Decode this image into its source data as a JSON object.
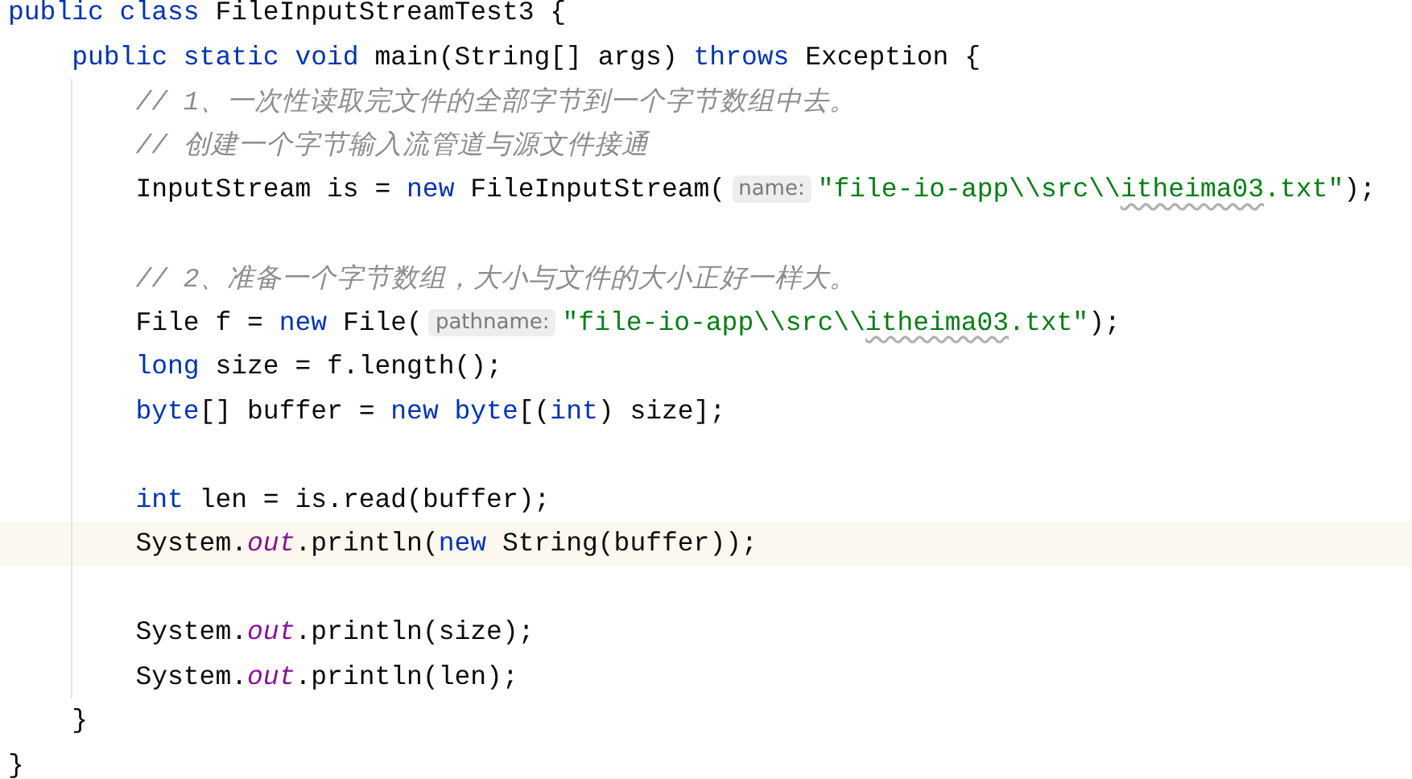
{
  "editor": {
    "lines": [
      {
        "current": false,
        "tokens": [
          {
            "kind": "keyword",
            "text": "public class"
          },
          {
            "kind": "plain",
            "text": " FileInputStreamTest3 {"
          }
        ],
        "children": [
          {
            "current": false,
            "tokens": [
              {
                "kind": "keyword",
                "text": "public static void"
              },
              {
                "kind": "plain",
                "text": " main(String[] args) "
              },
              {
                "kind": "keyword",
                "text": "throws"
              },
              {
                "kind": "plain",
                "text": " Exception {"
              }
            ],
            "children": [
              {
                "current": false,
                "tokens": [
                  {
                    "kind": "comment",
                    "text": "// 1、一次性读取完文件的全部字节到一个字节数组中去。"
                  }
                ]
              },
              {
                "current": false,
                "tokens": [
                  {
                    "kind": "comment",
                    "text": "// 创建一个字节输入流管道与源文件接通"
                  }
                ]
              },
              {
                "current": false,
                "tokens": [
                  {
                    "kind": "plain",
                    "text": "InputStream is = "
                  },
                  {
                    "kind": "keyword",
                    "text": "new"
                  },
                  {
                    "kind": "plain",
                    "text": " FileInputStream("
                  },
                  {
                    "kind": "hint",
                    "text": "name:"
                  },
                  {
                    "kind": "string",
                    "text": "\"file-io-app\\\\src\\\\"
                  },
                  {
                    "kind": "string",
                    "text": "itheima03",
                    "typo": true
                  },
                  {
                    "kind": "string",
                    "text": ".txt\""
                  },
                  {
                    "kind": "plain",
                    "text": ");"
                  }
                ]
              },
              {
                "current": false
              },
              {
                "current": false,
                "tokens": [
                  {
                    "kind": "comment",
                    "text": "// 2、准备一个字节数组，大小与文件的大小正好一样大。"
                  }
                ]
              },
              {
                "current": false,
                "tokens": [
                  {
                    "kind": "plain",
                    "text": "File f = "
                  },
                  {
                    "kind": "keyword",
                    "text": "new"
                  },
                  {
                    "kind": "plain",
                    "text": " File("
                  },
                  {
                    "kind": "hint",
                    "text": "pathname:"
                  },
                  {
                    "kind": "string",
                    "text": "\"file-io-app\\\\src\\\\"
                  },
                  {
                    "kind": "string",
                    "text": "itheima03",
                    "typo": true
                  },
                  {
                    "kind": "string",
                    "text": ".txt\""
                  },
                  {
                    "kind": "plain",
                    "text": ");"
                  }
                ]
              },
              {
                "current": false,
                "tokens": [
                  {
                    "kind": "keyword",
                    "text": "long"
                  },
                  {
                    "kind": "plain",
                    "text": " size = f.length();"
                  }
                ]
              },
              {
                "current": false,
                "tokens": [
                  {
                    "kind": "keyword",
                    "text": "byte"
                  },
                  {
                    "kind": "plain",
                    "text": "[] buffer = "
                  },
                  {
                    "kind": "keyword",
                    "text": "new byte"
                  },
                  {
                    "kind": "plain",
                    "text": "[("
                  },
                  {
                    "kind": "keyword",
                    "text": "int"
                  },
                  {
                    "kind": "plain",
                    "text": ") size];"
                  }
                ]
              },
              {
                "current": false
              },
              {
                "current": false,
                "tokens": [
                  {
                    "kind": "keyword",
                    "text": "int"
                  },
                  {
                    "kind": "plain",
                    "text": " len = is.read(buffer);"
                  }
                ]
              },
              {
                "current": true,
                "tokens": [
                  {
                    "kind": "plain",
                    "text": "System."
                  },
                  {
                    "kind": "static",
                    "text": "out"
                  },
                  {
                    "kind": "plain",
                    "text": ".println("
                  },
                  {
                    "kind": "keyword",
                    "text": "new"
                  },
                  {
                    "kind": "plain",
                    "text": " String(buffer));"
                  }
                ]
              },
              {
                "current": false
              },
              {
                "current": false,
                "tokens": [
                  {
                    "kind": "plain",
                    "text": "System."
                  },
                  {
                    "kind": "static",
                    "text": "out"
                  },
                  {
                    "kind": "plain",
                    "text": ".println(size);"
                  }
                ]
              },
              {
                "current": false,
                "tokens": [
                  {
                    "kind": "plain",
                    "text": "System."
                  },
                  {
                    "kind": "static",
                    "text": "out"
                  },
                  {
                    "kind": "plain",
                    "text": ".println(len);"
                  }
                ]
              }
            ]
          },
          {
            "current": false,
            "tokens": [
              {
                "kind": "plain",
                "text": "}"
              }
            ]
          }
        ]
      },
      {
        "current": false,
        "tokens": [
          {
            "kind": "plain",
            "text": "}"
          }
        ]
      }
    ]
  }
}
